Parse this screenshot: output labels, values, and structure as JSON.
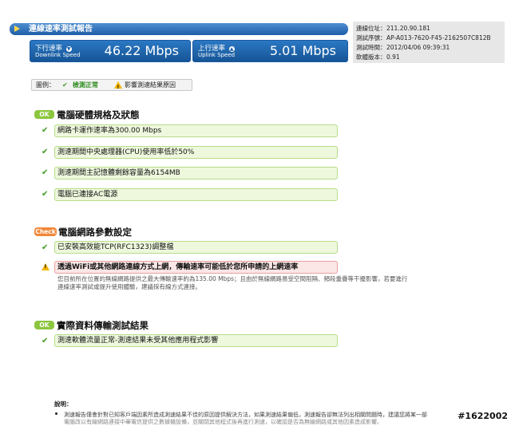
{
  "header": {
    "title": "連線速率測試報告",
    "downlink": {
      "label_zh": "下行速率",
      "label_en": "Downlink Speed",
      "value": "46.22 Mbps"
    },
    "uplink": {
      "label_zh": "上行速率",
      "label_en": "Uplink Speed",
      "value": "5.01 Mbps"
    }
  },
  "info": [
    {
      "key": "連線位址：",
      "value": "211.20.90.181"
    },
    {
      "key": "測試序號：",
      "value": "AP-A013-7620-F45-2162507C812B"
    },
    {
      "key": "測試時間：",
      "value": "2012/04/06 09:39:31"
    },
    {
      "key": "軟體版本：",
      "value": "0.91"
    }
  ],
  "legend": {
    "label": "圖例：",
    "ok_label": "檢測正常",
    "warn_label": "影響測速結果原因"
  },
  "sections": [
    {
      "badge": "OK",
      "title": "電腦硬體規格及狀態",
      "items": [
        "網路卡運作速率為300.00 Mbps",
        "測速期間中央處理器(CPU)使用率低於50%",
        "測速期間主記憶體剩餘容量為6154MB",
        "電腦已連接AC電源"
      ]
    },
    {
      "badge": "Check",
      "title": "電腦網路參數設定",
      "items": [
        "已安裝高效能TCP(RFC1323)調整檔",
        "透過WiFi或其他網路連線方式上網，傳輸速率可能低於您所申請的上網速率"
      ],
      "note_line1": "您目前所在位置的無線網路提供之最大傳輸速率約為135.00 Mbps；且由於無線網路易受空間阻隔、頻段重疊等干擾影響，若要進行",
      "note_line2": "連線速率測試或提升使用體驗，建議採有線方式連接。"
    },
    {
      "badge": "OK",
      "title": "實際資料傳輸測試結果",
      "items": [
        "測速軟體流量正常-測速結果未受其他應用程式影響"
      ]
    }
  ],
  "footer": {
    "title": "說明：",
    "line1": "測速報告僅會針對已知客戶端因素所造成測速結果不佳的原因提供解決方法，如果測速結果偏低，測速報告卻無法列出相關問題時，建議您將某一部",
    "line2": "電腦改以有線網路連接中華電信提供之數據機設備，並關閉其他程式後再進行測速，以確認是否為無線網路或其他因素造成影響。"
  },
  "watermark": "#1622002",
  "colors": {
    "title_bar": "#2b6cb5",
    "speed_box": "#1f64ac",
    "ok_badge": "#8cc63e",
    "check_badge": "#f0883a",
    "item_bg": "#eef8dd"
  }
}
